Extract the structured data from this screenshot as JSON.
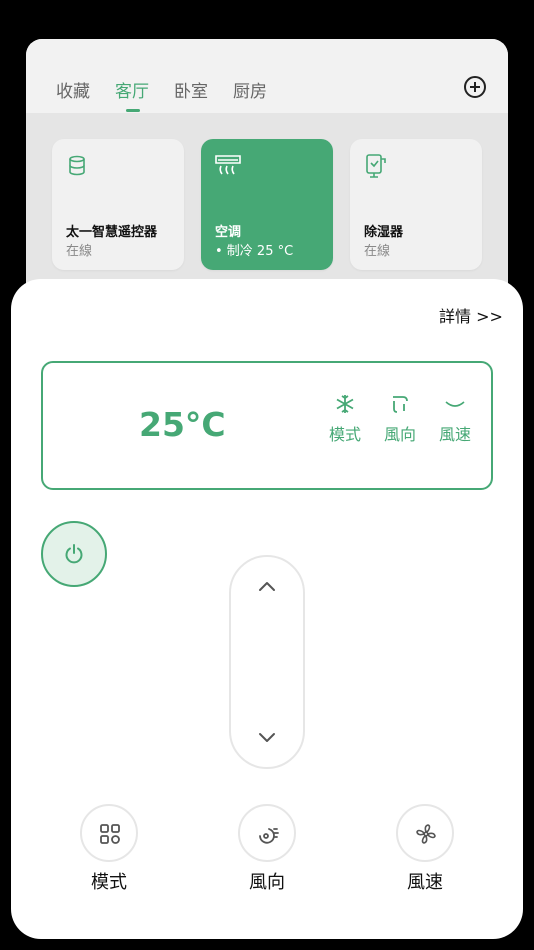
{
  "tabs": [
    {
      "label": "收藏",
      "active": false
    },
    {
      "label": "客厅",
      "active": true
    },
    {
      "label": "卧室",
      "active": false
    },
    {
      "label": "厨房",
      "active": false
    }
  ],
  "devices": [
    {
      "name": "太一智慧遥控器",
      "status": "在線",
      "icon": "remote-hub-icon",
      "active": false
    },
    {
      "name": "空调",
      "status": "• 制冷 25 °C",
      "icon": "air-conditioner-icon",
      "active": true
    },
    {
      "name": "除湿器",
      "status": "在線",
      "icon": "dehumidifier-icon",
      "active": false
    }
  ],
  "sheet": {
    "details_link": "詳情 >>",
    "temperature": "25°C",
    "status_items": [
      {
        "label": "模式",
        "icon": "snowflake-icon"
      },
      {
        "label": "風向",
        "icon": "swing-icon"
      },
      {
        "label": "風速",
        "icon": "wind-wave-icon"
      }
    ],
    "bottom_controls": [
      {
        "label": "模式",
        "icon": "mode-grid-icon"
      },
      {
        "label": "風向",
        "icon": "air-direction-icon"
      },
      {
        "label": "風速",
        "icon": "fan-icon"
      }
    ]
  },
  "colors": {
    "accent": "#46a875",
    "accent_light": "#e3f2e9"
  }
}
